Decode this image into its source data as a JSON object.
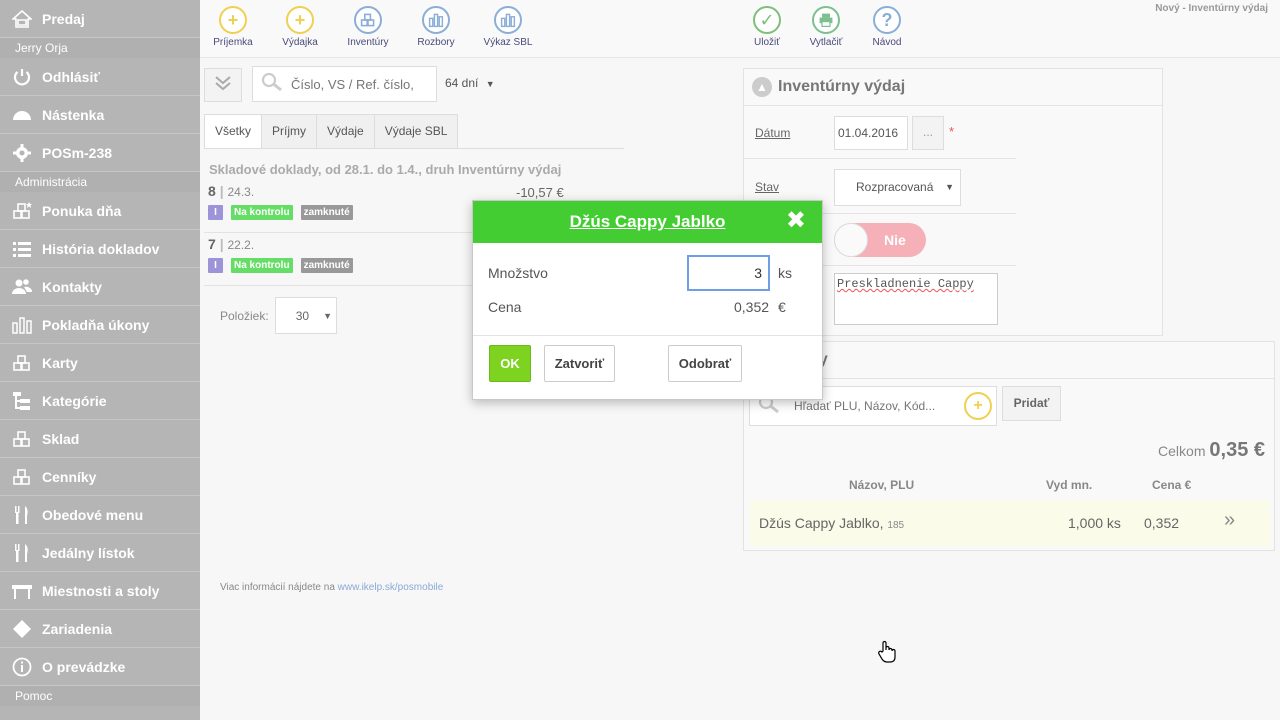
{
  "sidebar": {
    "items": [
      {
        "label": "Predaj",
        "icon": "home-icon"
      },
      {
        "section": "Jerry Orja"
      },
      {
        "label": "Odhlásiť",
        "icon": "power-icon"
      },
      {
        "label": "Nástenka",
        "icon": "dashboard-icon"
      },
      {
        "label": "POSm-238",
        "icon": "gear-icon"
      },
      {
        "section": "Administrácia"
      },
      {
        "label": "Ponuka dňa",
        "icon": "blocks-star-icon"
      },
      {
        "label": "História dokladov",
        "icon": "list-icon"
      },
      {
        "label": "Kontakty",
        "icon": "users-icon"
      },
      {
        "label": "Pokladňa úkony",
        "icon": "bars-icon"
      },
      {
        "label": "Karty",
        "icon": "blocks-icon"
      },
      {
        "label": "Kategórie",
        "icon": "tree-icon"
      },
      {
        "label": "Sklad",
        "icon": "blocks-icon"
      },
      {
        "label": "Cenníky",
        "icon": "blocks-icon"
      },
      {
        "label": "Obedové menu",
        "icon": "cutlery-icon"
      },
      {
        "label": "Jedálny lístok",
        "icon": "cutlery-icon"
      },
      {
        "label": "Miestnosti a stoly",
        "icon": "table-icon"
      },
      {
        "label": "Zariadenia",
        "icon": "diamond-icon"
      },
      {
        "label": "O prevádzke",
        "icon": "info-icon"
      },
      {
        "section": "Pomoc"
      }
    ]
  },
  "toolbar": {
    "left_buttons": [
      "Príjemka",
      "Výdajka",
      "Inventúry",
      "Rozbory",
      "Výkaz SBL"
    ],
    "right_buttons": [
      "Uložiť",
      "Vytlačiť",
      "Návod"
    ],
    "window_title": "Nový - Inventúrny výdaj"
  },
  "filter": {
    "search_placeholder": "Číslo, VS / Ref. číslo,",
    "days": "64 dní"
  },
  "tabs": [
    "Všetky",
    "Príjmy",
    "Výdaje",
    "Výdaje SBL"
  ],
  "list": {
    "heading": "Skladové doklady, od 28.1. do 1.4., druh Inventúrny výdaj",
    "rows": [
      {
        "number": "8",
        "date": "24.3.",
        "amount": "-10,57 €",
        "badges": [
          "I",
          "Na kontrolu",
          "zamknuté"
        ]
      },
      {
        "number": "7",
        "date": "22.2.",
        "amount": "",
        "badges": [
          "I",
          "Na kontrolu",
          "zamknuté"
        ]
      }
    ],
    "per_page_label": "Položiek:",
    "per_page_value": "30"
  },
  "footer": {
    "text": "Viac informácií nájdete na ",
    "link": "www.ikelp.sk/posmobile"
  },
  "document_panel": {
    "title": "Inventúrny výdaj",
    "date_label": "Dátum",
    "date_value": "01.04.2016",
    "date_button": "...",
    "required_mark": "*",
    "state_label": "Stav",
    "state_value": "Rozpracovaná",
    "toggle_label": "Nie",
    "note": "Preskladnenie Cappy"
  },
  "items_panel": {
    "title_visible": "ky",
    "search_placeholder": "Hľadať PLU, Názov, Kód...",
    "add_button": "Pridať",
    "total_label": "Celkom",
    "total_value": "0,35 €",
    "columns": [
      "Názov, PLU",
      "Vyd mn.",
      "Cena €"
    ],
    "rows": [
      {
        "name": "Džús Cappy Jablko,",
        "plu": "185",
        "qty": "1,000 ks",
        "price": "0,352"
      }
    ]
  },
  "modal": {
    "title": "Džús Cappy Jablko",
    "qty_label": "Množstvo",
    "qty_value": "3",
    "qty_unit": "ks",
    "price_label": "Cena",
    "price_value": "0,352",
    "currency": "€",
    "ok": "OK",
    "close": "Zatvoriť",
    "remove": "Odobrať"
  },
  "colors": {
    "sidebar_bg": "#b5b5b5",
    "modal_header": "#44cc33",
    "ok_button": "#7ed321",
    "toggle_off": "#f5b0b8"
  }
}
